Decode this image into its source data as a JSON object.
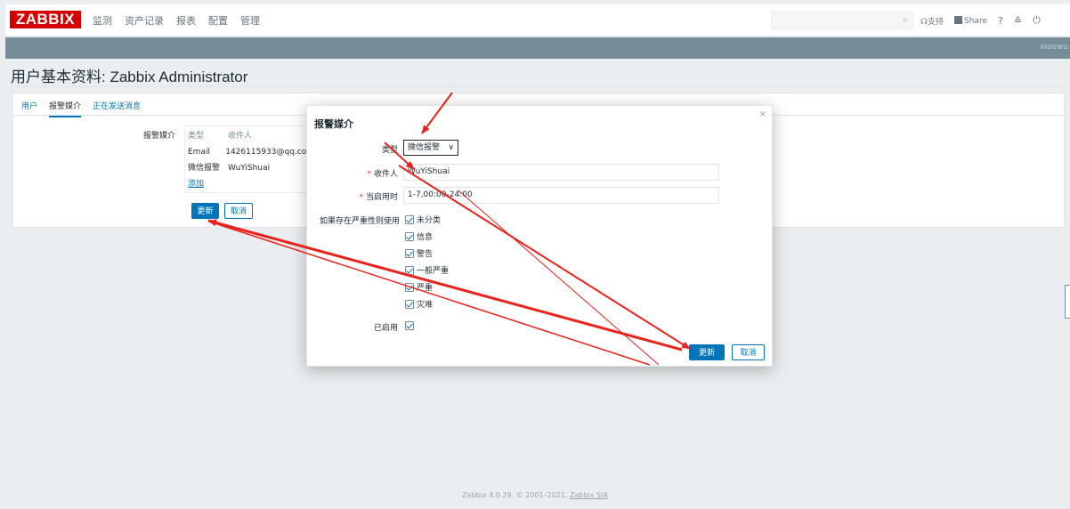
{
  "header": {
    "logo": "ZABBIX",
    "nav": [
      "监测",
      "资产记录",
      "报表",
      "配置",
      "管理"
    ],
    "support": "支持",
    "share": "Share",
    "help": "?",
    "user_icon": "person-icon",
    "logout_icon": "power-icon"
  },
  "userbar": {
    "username": "xiaowu"
  },
  "page": {
    "title": "用户基本资料: Zabbix Administrator"
  },
  "tabs": [
    {
      "label": "用户"
    },
    {
      "label": "报警媒介"
    },
    {
      "label": "正在发送消息"
    }
  ],
  "media": {
    "label": "报警媒介",
    "headers": [
      "类型",
      "收件人"
    ],
    "rows": [
      {
        "type": "Email",
        "recipient": "1426115933@qq.com"
      },
      {
        "type": "微信报警",
        "recipient": "WuYiShuai"
      }
    ],
    "add_label": "添加",
    "update_label": "更新",
    "cancel_label": "取消"
  },
  "modal": {
    "title": "报警媒介",
    "close": "×",
    "type_label": "类型",
    "type_value": "微信报警",
    "recipient_label": "收件人",
    "recipient_value": "WuYiShuai",
    "when_active_label": "当启用时",
    "when_active_value": "1-7,00:00-24:00",
    "severity_label": "如果存在严重性则使用",
    "severities": [
      {
        "label": "未分类",
        "checked": true
      },
      {
        "label": "信息",
        "checked": true
      },
      {
        "label": "警告",
        "checked": true
      },
      {
        "label": "一般严重",
        "checked": true
      },
      {
        "label": "严重",
        "checked": true
      },
      {
        "label": "灾难",
        "checked": true
      }
    ],
    "enabled_label": "已启用",
    "enabled": true,
    "update_label": "更新",
    "cancel_label": "取消"
  },
  "footer": {
    "text": "Zabbix 4.0.29. © 2001–2021,",
    "link": "Zabbix SIA"
  },
  "colors": {
    "brand": "#d40000",
    "accent": "#0275b8",
    "userbar": "#768d99",
    "annotation": "#e8231c"
  }
}
